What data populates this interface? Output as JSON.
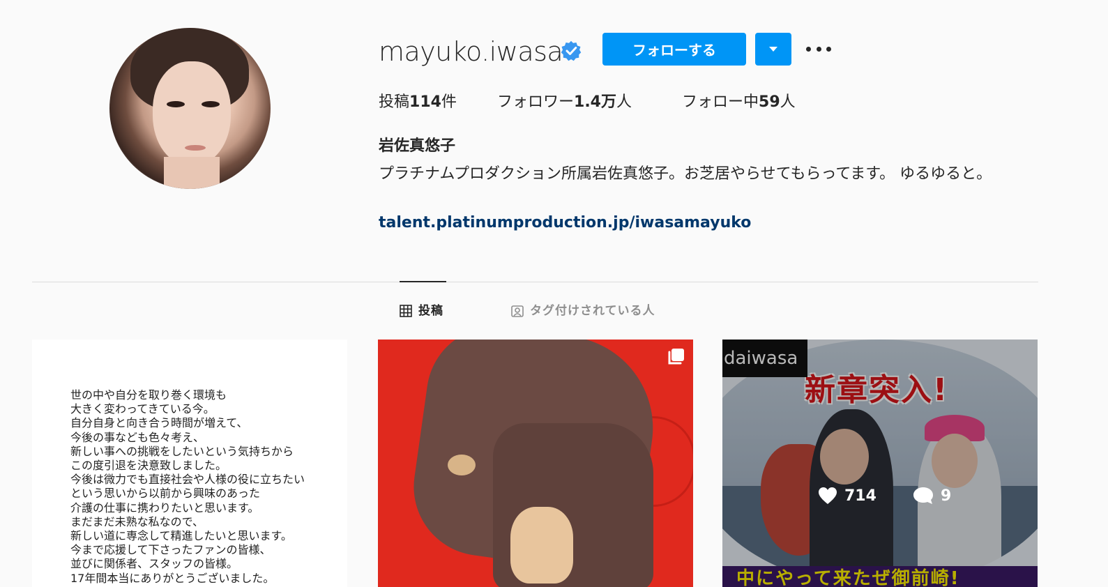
{
  "profile": {
    "username": "mayuko.iwasa",
    "verified": true,
    "follow_label": "フォローする",
    "stats": {
      "posts_label": "投稿",
      "posts_count": "114",
      "posts_unit": "件",
      "followers_label": "フォロワー",
      "followers_count": "1.4万",
      "followers_unit": "人",
      "following_label": "フォロー中",
      "following_count": "59",
      "following_unit": "人"
    },
    "full_name": "岩佐真悠子",
    "bio": "プラチナムプロダクション所属岩佐真悠子。お芝居やらせてもらってます。 ゆるゆると。",
    "link": "talent.platinumproduction.jp/iwasamayuko"
  },
  "tabs": [
    {
      "label": "投稿",
      "icon": "grid-icon",
      "active": true
    },
    {
      "label": "タグ付けされている人",
      "icon": "tagged-user-icon",
      "active": false
    }
  ],
  "posts": [
    {
      "type": "text-image",
      "text": "世の中や自分を取り巻く環境も\n大きく変わってきている今。\n自分自身と向き合う時間が増えて、\n今後の事なども色々考え、\n新しい事への挑戦をしたいという気持ちから\nこの度引退を決意致しました。\n今後は微力でも直接社会や人様の役に立ちたい\nという思いから以前から興味のあった\n介護の仕事に携わりたいと思います。\nまだまだ未熟な私なので、\n新しい道に専念して精進したいと思います。\n今まで応援して下さったファンの皆様、\n並びに関係者、スタッフの皆様。\n17年間本当にありがとうございました。"
    },
    {
      "type": "photo",
      "multiple": true,
      "icon": "carousel-icon"
    },
    {
      "type": "photo",
      "corner_label": "daiwasa",
      "headline": "新章突入!",
      "bottom_text": "中にやって来たぜ御前崎!",
      "likes": "714",
      "comments": "9"
    }
  ],
  "colors": {
    "primary_button": "#0095f6",
    "link": "#00376b",
    "text": "#262626",
    "muted": "#8e8e8e"
  }
}
